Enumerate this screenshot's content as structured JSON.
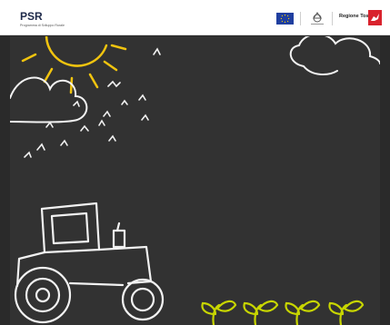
{
  "header": {
    "psr_logo_text": "PSR",
    "psr_tagline": "Programma di Sviluppo Rurale",
    "region_name": "Regione Toscana"
  },
  "colors": {
    "board": "#323232",
    "chalk": "#f2f2f2",
    "sun": "#f1c40f",
    "sprout": "#c8d600"
  },
  "illustration": {
    "sun": "sun-icon",
    "clouds": "cloud-icon",
    "birds": "bird-icon",
    "tractor": "tractor-icon",
    "sprouts": "sprout-icon"
  }
}
